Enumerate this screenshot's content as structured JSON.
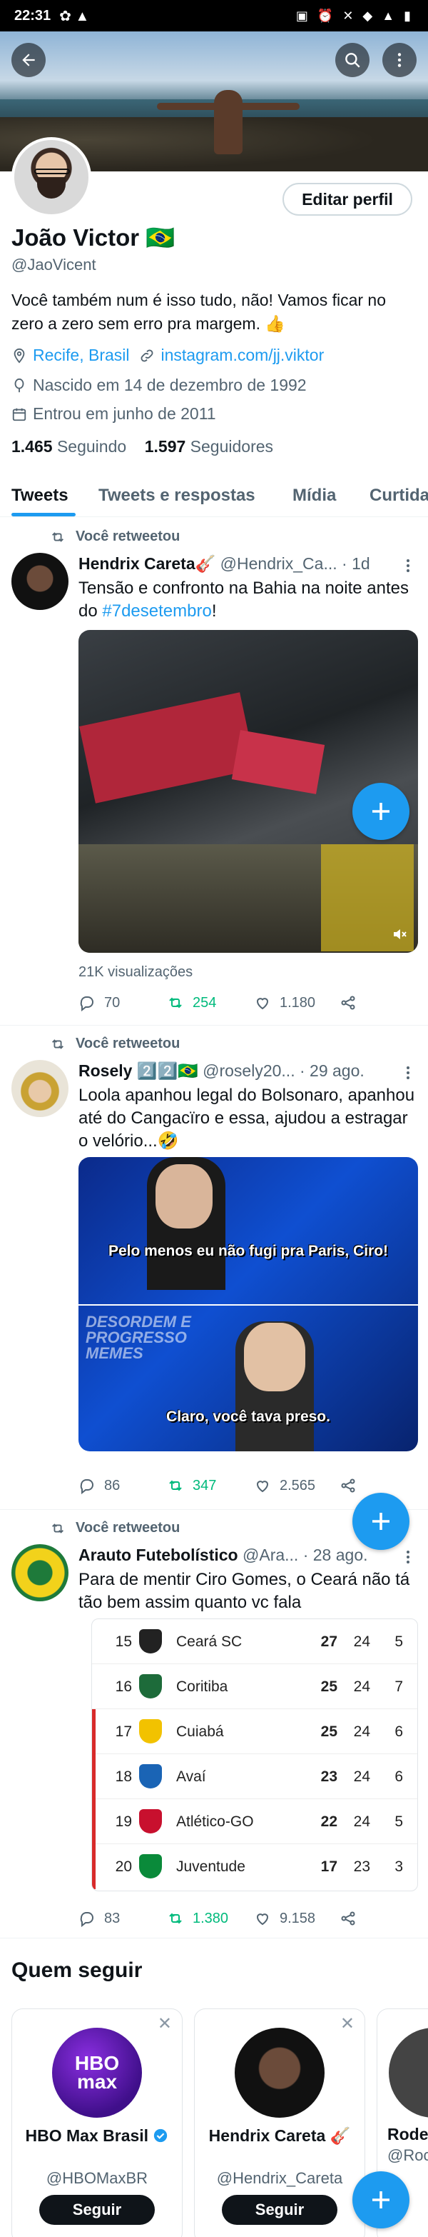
{
  "status_bar": {
    "time": "22:31"
  },
  "profile": {
    "edit_label": "Editar perfil",
    "name": "João Victor",
    "flag": "🇧🇷",
    "handle": "@JaoVicent",
    "bio": "Você também num é isso tudo, não! Vamos ficar no zero a zero sem erro pra margem. 👍",
    "location": "Recife, Brasil",
    "website": "instagram.com/jj.viktor",
    "birth": "Nascido em 14 de dezembro de 1992",
    "joined": "Entrou em junho de 2011",
    "following_count": "1.465",
    "following_label": "Seguindo",
    "followers_count": "1.597",
    "followers_label": "Seguidores"
  },
  "tabs": [
    {
      "label": "Tweets",
      "active": true
    },
    {
      "label": "Tweets e respostas",
      "active": false
    },
    {
      "label": "Mídia",
      "active": false
    },
    {
      "label": "Curtidas",
      "active": false
    }
  ],
  "tweets": [
    {
      "retweet_label": "Você retweetou",
      "name": "Hendrix Careta🎸",
      "handle": "@Hendrix_Ca...",
      "time": "· 1d",
      "text_before": "Tensão e confronto na Bahia na noite antes do ",
      "hashtag": "#7desetembro",
      "text_after": "!",
      "views": "21K visualizações",
      "replies": "70",
      "retweets": "254",
      "likes": "1.180"
    },
    {
      "retweet_label": "Você retweetou",
      "name": "Rosely 2️⃣2️⃣🇧🇷",
      "handle": "@rosely20...",
      "time": "· 29 ago.",
      "text": "Loola apanhou legal do Bolsonaro, apanhou até do Cangacïro  e essa, ajudou a estragar o velório...🤣",
      "caption_top": "Pelo menos eu não fugi pra Paris, Ciro!",
      "caption_overlay": "DESORDEM E PROGRESSO MEMES",
      "caption_bottom": "Claro, você tava preso.",
      "replies": "86",
      "retweets": "347",
      "likes": "2.565"
    },
    {
      "retweet_label": "Você retweetou",
      "name": "Arauto Futebolístico",
      "handle": "@Ara...",
      "time": "· 28 ago.",
      "text": "Para de mentir Ciro Gomes, o Ceará não tá tão bem assim quanto vc fala",
      "table": [
        {
          "pos": "15",
          "team": "Ceará SC",
          "pts": "27",
          "games": "24",
          "wins": "5",
          "zone": false,
          "crest": "#222222"
        },
        {
          "pos": "16",
          "team": "Coritiba",
          "pts": "25",
          "games": "24",
          "wins": "7",
          "zone": false,
          "crest": "#1d6b3a"
        },
        {
          "pos": "17",
          "team": "Cuiabá",
          "pts": "25",
          "games": "24",
          "wins": "6",
          "zone": true,
          "crest": "#f2c200"
        },
        {
          "pos": "18",
          "team": "Avaí",
          "pts": "23",
          "games": "24",
          "wins": "6",
          "zone": true,
          "crest": "#1a64b5"
        },
        {
          "pos": "19",
          "team": "Atlético-GO",
          "pts": "22",
          "games": "24",
          "wins": "5",
          "zone": true,
          "crest": "#c8102e"
        },
        {
          "pos": "20",
          "team": "Juventude",
          "pts": "17",
          "games": "23",
          "wins": "3",
          "zone": true,
          "crest": "#0a8a3a"
        }
      ],
      "replies": "83",
      "retweets": "1.380",
      "likes": "9.158"
    }
  ],
  "who_to_follow": {
    "title": "Quem seguir",
    "follow_label": "Seguir",
    "cards": [
      {
        "name": "HBO Max Brasil",
        "handle": "@HBOMaxBR",
        "logo_text": "HBO max"
      },
      {
        "name": "Hendrix Careta 🎸",
        "handle": "@Hendrix_Careta"
      },
      {
        "name": "Rode",
        "handle": "@Roc"
      }
    ]
  },
  "colors": {
    "accent": "#1d9bf0",
    "retweet_green": "#00ba7c",
    "text": "#0f1419",
    "muted": "#536471"
  }
}
